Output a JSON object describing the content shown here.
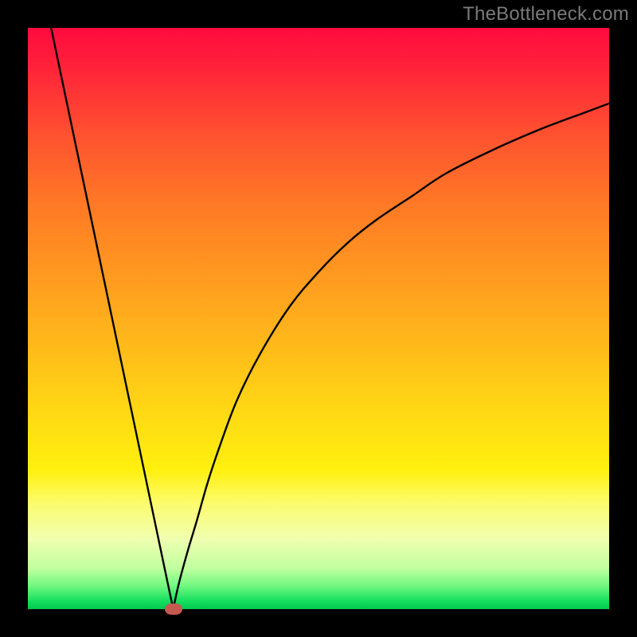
{
  "watermark": "TheBottleneck.com",
  "chart_data": {
    "type": "line",
    "title": "",
    "xlabel": "",
    "ylabel": "",
    "xlim": [
      0,
      100
    ],
    "ylim": [
      0,
      100
    ],
    "series": [
      {
        "name": "left-branch",
        "x": [
          4,
          6,
          8,
          10,
          12,
          14,
          16,
          18,
          20,
          21.5,
          23,
          24,
          25
        ],
        "y": [
          100,
          90.4,
          80.8,
          71.3,
          61.7,
          52.2,
          42.6,
          33.0,
          23.5,
          16.3,
          9.1,
          4.3,
          0
        ]
      },
      {
        "name": "right-branch",
        "x": [
          25,
          26,
          27.5,
          29,
          31,
          33,
          36,
          40,
          45,
          50,
          55,
          60,
          66,
          72,
          80,
          88,
          96,
          100
        ],
        "y": [
          0,
          4.5,
          10,
          15,
          22,
          28,
          36,
          44,
          52,
          58,
          63,
          67,
          71,
          75,
          79,
          82.5,
          85.5,
          87
        ]
      }
    ],
    "marker": {
      "x": 25,
      "y": 0,
      "color": "#c45a4f"
    },
    "gradient_stops": [
      {
        "pos": 0,
        "color": "#ff0b3e"
      },
      {
        "pos": 0.06,
        "color": "#ff1f3a"
      },
      {
        "pos": 0.18,
        "color": "#ff5030"
      },
      {
        "pos": 0.3,
        "color": "#ff7826"
      },
      {
        "pos": 0.42,
        "color": "#ff9820"
      },
      {
        "pos": 0.54,
        "color": "#ffb81a"
      },
      {
        "pos": 0.66,
        "color": "#ffd814"
      },
      {
        "pos": 0.76,
        "color": "#fff00e"
      },
      {
        "pos": 0.82,
        "color": "#fcfc70"
      },
      {
        "pos": 0.88,
        "color": "#f0ffb0"
      },
      {
        "pos": 0.93,
        "color": "#c0ffa0"
      },
      {
        "pos": 0.96,
        "color": "#70f880"
      },
      {
        "pos": 0.985,
        "color": "#18e060"
      },
      {
        "pos": 1.0,
        "color": "#00c850"
      }
    ]
  }
}
